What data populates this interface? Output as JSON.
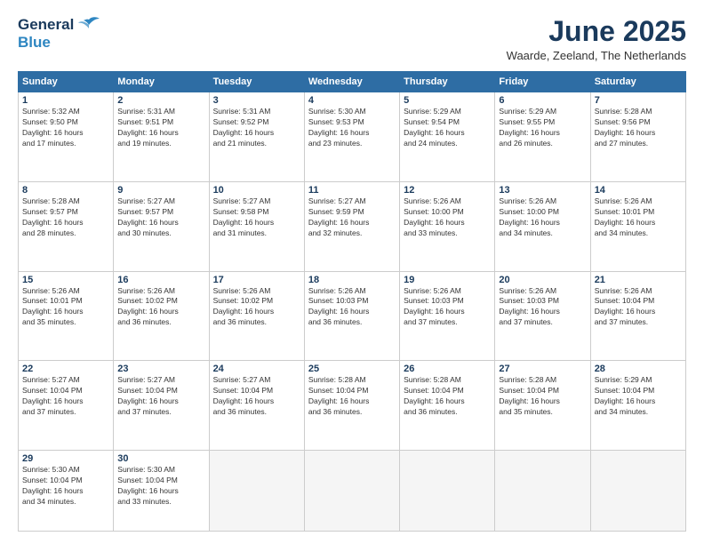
{
  "header": {
    "logo": {
      "general": "General",
      "blue": "Blue"
    },
    "title": "June 2025",
    "subtitle": "Waarde, Zeeland, The Netherlands"
  },
  "calendar": {
    "days_of_week": [
      "Sunday",
      "Monday",
      "Tuesday",
      "Wednesday",
      "Thursday",
      "Friday",
      "Saturday"
    ],
    "weeks": [
      [
        {
          "day": "1",
          "info": "Sunrise: 5:32 AM\nSunset: 9:50 PM\nDaylight: 16 hours\nand 17 minutes."
        },
        {
          "day": "2",
          "info": "Sunrise: 5:31 AM\nSunset: 9:51 PM\nDaylight: 16 hours\nand 19 minutes."
        },
        {
          "day": "3",
          "info": "Sunrise: 5:31 AM\nSunset: 9:52 PM\nDaylight: 16 hours\nand 21 minutes."
        },
        {
          "day": "4",
          "info": "Sunrise: 5:30 AM\nSunset: 9:53 PM\nDaylight: 16 hours\nand 23 minutes."
        },
        {
          "day": "5",
          "info": "Sunrise: 5:29 AM\nSunset: 9:54 PM\nDaylight: 16 hours\nand 24 minutes."
        },
        {
          "day": "6",
          "info": "Sunrise: 5:29 AM\nSunset: 9:55 PM\nDaylight: 16 hours\nand 26 minutes."
        },
        {
          "day": "7",
          "info": "Sunrise: 5:28 AM\nSunset: 9:56 PM\nDaylight: 16 hours\nand 27 minutes."
        }
      ],
      [
        {
          "day": "8",
          "info": "Sunrise: 5:28 AM\nSunset: 9:57 PM\nDaylight: 16 hours\nand 28 minutes."
        },
        {
          "day": "9",
          "info": "Sunrise: 5:27 AM\nSunset: 9:57 PM\nDaylight: 16 hours\nand 30 minutes."
        },
        {
          "day": "10",
          "info": "Sunrise: 5:27 AM\nSunset: 9:58 PM\nDaylight: 16 hours\nand 31 minutes."
        },
        {
          "day": "11",
          "info": "Sunrise: 5:27 AM\nSunset: 9:59 PM\nDaylight: 16 hours\nand 32 minutes."
        },
        {
          "day": "12",
          "info": "Sunrise: 5:26 AM\nSunset: 10:00 PM\nDaylight: 16 hours\nand 33 minutes."
        },
        {
          "day": "13",
          "info": "Sunrise: 5:26 AM\nSunset: 10:00 PM\nDaylight: 16 hours\nand 34 minutes."
        },
        {
          "day": "14",
          "info": "Sunrise: 5:26 AM\nSunset: 10:01 PM\nDaylight: 16 hours\nand 34 minutes."
        }
      ],
      [
        {
          "day": "15",
          "info": "Sunrise: 5:26 AM\nSunset: 10:01 PM\nDaylight: 16 hours\nand 35 minutes."
        },
        {
          "day": "16",
          "info": "Sunrise: 5:26 AM\nSunset: 10:02 PM\nDaylight: 16 hours\nand 36 minutes."
        },
        {
          "day": "17",
          "info": "Sunrise: 5:26 AM\nSunset: 10:02 PM\nDaylight: 16 hours\nand 36 minutes."
        },
        {
          "day": "18",
          "info": "Sunrise: 5:26 AM\nSunset: 10:03 PM\nDaylight: 16 hours\nand 36 minutes."
        },
        {
          "day": "19",
          "info": "Sunrise: 5:26 AM\nSunset: 10:03 PM\nDaylight: 16 hours\nand 37 minutes."
        },
        {
          "day": "20",
          "info": "Sunrise: 5:26 AM\nSunset: 10:03 PM\nDaylight: 16 hours\nand 37 minutes."
        },
        {
          "day": "21",
          "info": "Sunrise: 5:26 AM\nSunset: 10:04 PM\nDaylight: 16 hours\nand 37 minutes."
        }
      ],
      [
        {
          "day": "22",
          "info": "Sunrise: 5:27 AM\nSunset: 10:04 PM\nDaylight: 16 hours\nand 37 minutes."
        },
        {
          "day": "23",
          "info": "Sunrise: 5:27 AM\nSunset: 10:04 PM\nDaylight: 16 hours\nand 37 minutes."
        },
        {
          "day": "24",
          "info": "Sunrise: 5:27 AM\nSunset: 10:04 PM\nDaylight: 16 hours\nand 36 minutes."
        },
        {
          "day": "25",
          "info": "Sunrise: 5:28 AM\nSunset: 10:04 PM\nDaylight: 16 hours\nand 36 minutes."
        },
        {
          "day": "26",
          "info": "Sunrise: 5:28 AM\nSunset: 10:04 PM\nDaylight: 16 hours\nand 36 minutes."
        },
        {
          "day": "27",
          "info": "Sunrise: 5:28 AM\nSunset: 10:04 PM\nDaylight: 16 hours\nand 35 minutes."
        },
        {
          "day": "28",
          "info": "Sunrise: 5:29 AM\nSunset: 10:04 PM\nDaylight: 16 hours\nand 34 minutes."
        }
      ],
      [
        {
          "day": "29",
          "info": "Sunrise: 5:30 AM\nSunset: 10:04 PM\nDaylight: 16 hours\nand 34 minutes."
        },
        {
          "day": "30",
          "info": "Sunrise: 5:30 AM\nSunset: 10:04 PM\nDaylight: 16 hours\nand 33 minutes."
        },
        {
          "day": "",
          "info": ""
        },
        {
          "day": "",
          "info": ""
        },
        {
          "day": "",
          "info": ""
        },
        {
          "day": "",
          "info": ""
        },
        {
          "day": "",
          "info": ""
        }
      ]
    ]
  }
}
